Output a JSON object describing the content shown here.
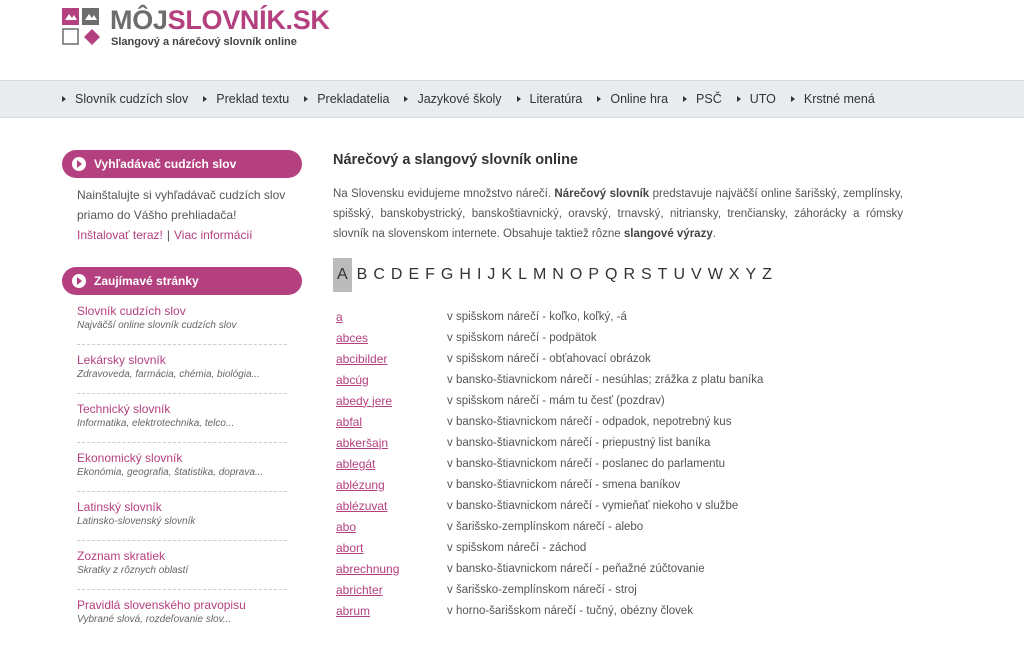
{
  "header": {
    "title_a": "MÔJ",
    "title_b": "SLOVNÍK.SK",
    "subtitle": "Slangový a nárečový slovník online"
  },
  "nav": [
    "Slovník cudzích slov",
    "Preklad textu",
    "Prekladatelia",
    "Jazykové školy",
    "Literatúra",
    "Online hra",
    "PSČ",
    "UTO",
    "Krstné mená"
  ],
  "sidebar": {
    "box1": {
      "title": "Vyhľadávač cudzích slov",
      "text": "Nainštalujte si vyhľadávač cudzích slov priamo do Vášho prehliadača!",
      "link1": "Inštalovať teraz!",
      "sep": "|",
      "link2": "Viac informácií"
    },
    "box2": {
      "title": "Zaujímavé stránky",
      "items": [
        {
          "title": "Slovník cudzích slov",
          "desc": "Najväčší online slovník cudzích slov"
        },
        {
          "title": "Lekársky slovník",
          "desc": "Zdravoveda, farmácia, chémia, biológia..."
        },
        {
          "title": "Technický slovník",
          "desc": "Informatika, elektrotechnika, telco..."
        },
        {
          "title": "Ekonomický slovník",
          "desc": "Ekonómia, geografia, štatistika, doprava..."
        },
        {
          "title": "Latinský slovník",
          "desc": "Latinsko-slovenský slovník"
        },
        {
          "title": "Zoznam skratiek",
          "desc": "Skratky z rôznych oblastí"
        },
        {
          "title": "Pravidlá slovenského pravopisu",
          "desc": "Vybrané slová, rozdeľovanie slov..."
        }
      ]
    }
  },
  "main": {
    "heading": "Nárečový a slangový slovník online",
    "intro_1": "Na Slovensku evidujeme množstvo nárečí. ",
    "intro_b1": "Nárečový slovník",
    "intro_2": " predstavuje najväčší online šarišský, zemplínsky, spišský, banskobystrický, banskoštiavnický, oravský, trnavský, nitriansky, trenčiansky, záhorácky a rómsky slovník na slovenskom internete. Obsahuje taktiež rôzne ",
    "intro_b2": "slangové výrazy",
    "intro_3": ".",
    "letters": [
      "A",
      "B",
      "C",
      "D",
      "E",
      "F",
      "G",
      "H",
      "I",
      "J",
      "K",
      "L",
      "M",
      "N",
      "O",
      "P",
      "Q",
      "R",
      "S",
      "T",
      "U",
      "V",
      "W",
      "X",
      "Y",
      "Z"
    ],
    "active_letter": "A",
    "entries": [
      {
        "word": "a",
        "meaning": "v spišskom nárečí - koľko, koľký, -á"
      },
      {
        "word": "abces",
        "meaning": "v spišskom nárečí - podpätok"
      },
      {
        "word": "abcibilder",
        "meaning": "v spišskom nárečí - obťahovací obrázok"
      },
      {
        "word": "abcúg",
        "meaning": "v bansko-štiavnickom nárečí - nesúhlas; zrážka z platu baníka"
      },
      {
        "word": "abedy jere",
        "meaning": "v spišskom nárečí - mám tu česť (pozdrav)"
      },
      {
        "word": "abfal",
        "meaning": "v bansko-štiavnickom nárečí - odpadok, nepotrebný kus"
      },
      {
        "word": "abkeršajn",
        "meaning": "v bansko-štiavnickom nárečí - priepustný list baníka"
      },
      {
        "word": "ablegát",
        "meaning": "v bansko-štiavnickom nárečí - poslanec do parlamentu"
      },
      {
        "word": "ablézung",
        "meaning": "v bansko-štiavnickom nárečí - smena baníkov"
      },
      {
        "word": "ablézuvat",
        "meaning": "v bansko-štiavnickom nárečí - vymieňať niekoho v službe"
      },
      {
        "word": "abo",
        "meaning": "v šarišsko-zemplínskom nárečí - alebo"
      },
      {
        "word": "abort",
        "meaning": "v spišskom nárečí - záchod"
      },
      {
        "word": "abrechnung",
        "meaning": "v bansko-štiavnickom nárečí - peňažné zúčtovanie"
      },
      {
        "word": "abrichter",
        "meaning": "v šarišsko-zemplínskom nárečí - stroj"
      },
      {
        "word": "abrum",
        "meaning": "v horno-šarišskom nárečí - tučný, obézny človek"
      }
    ]
  },
  "colors": {
    "brand": "#b5407f",
    "nav_bg": "#e8ecef"
  }
}
